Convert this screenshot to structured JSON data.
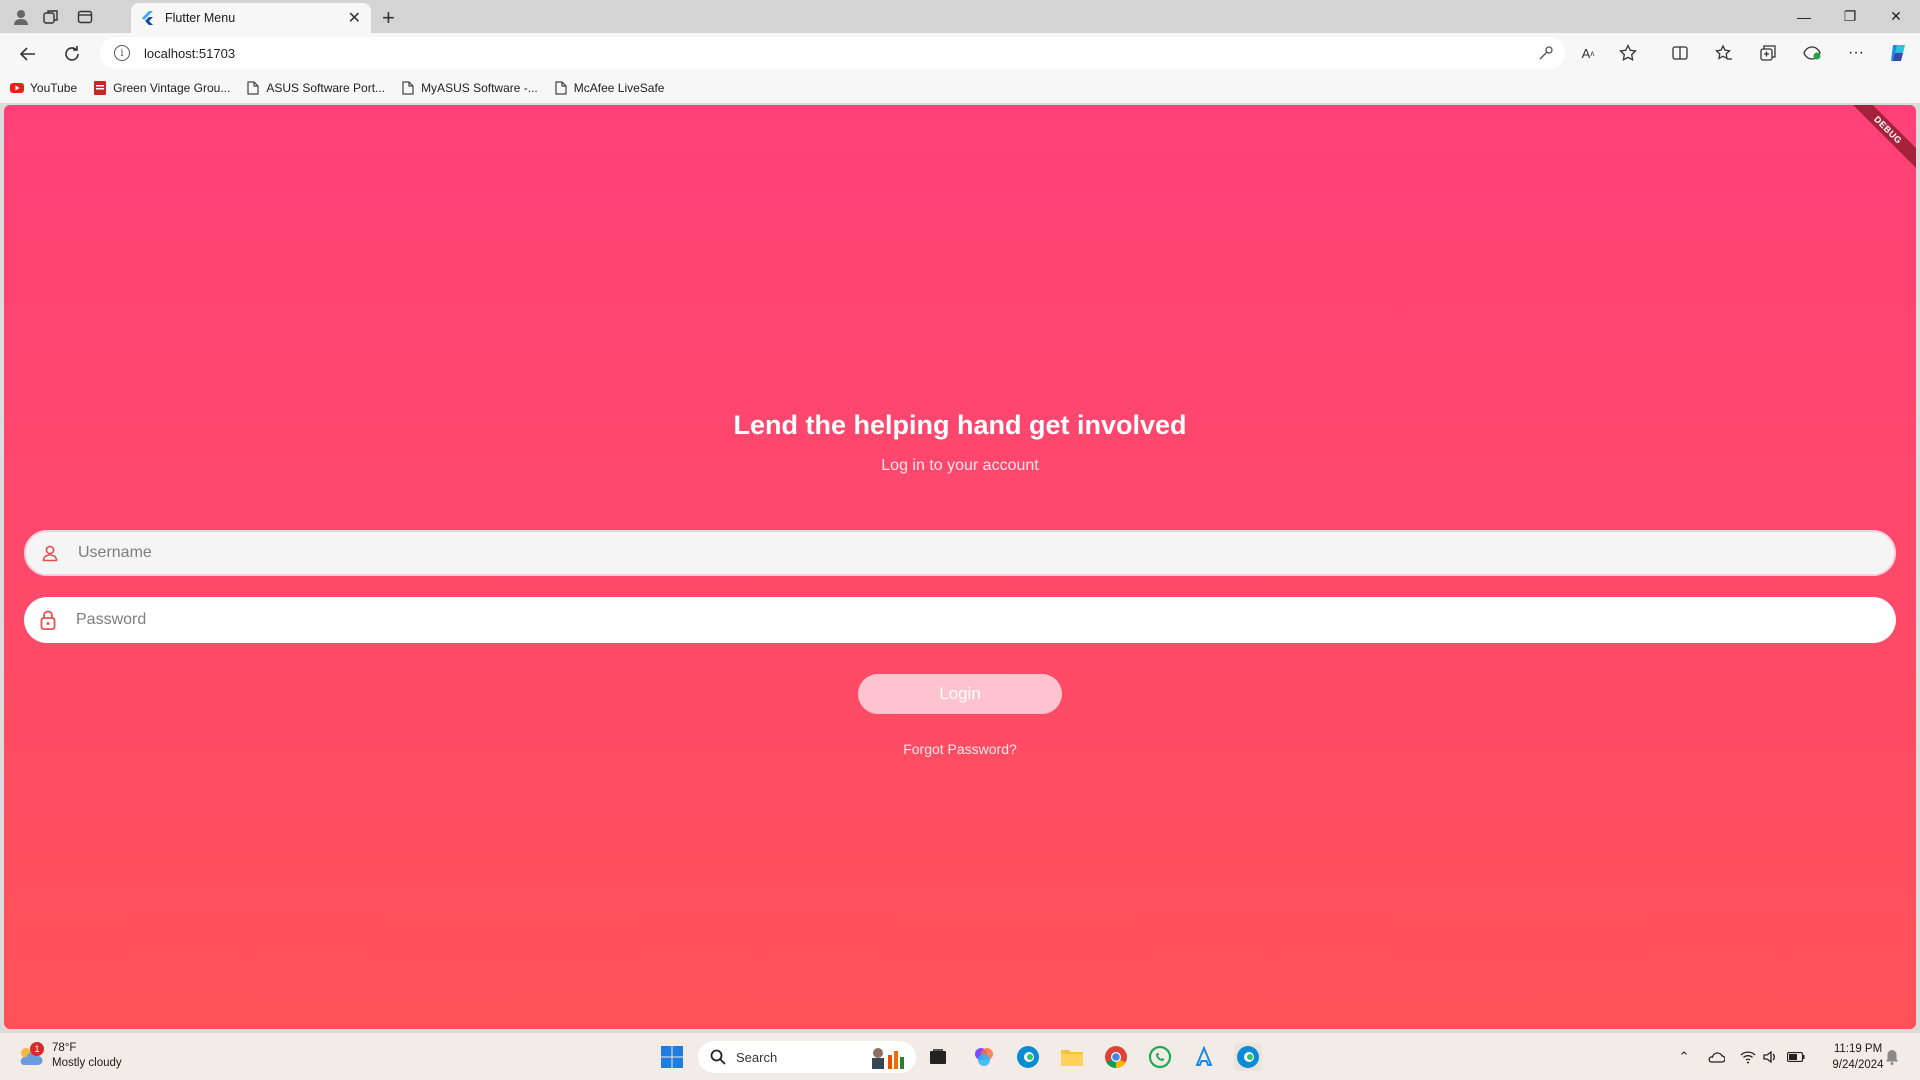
{
  "browser": {
    "tab_title": "Flutter Menu",
    "url": "localhost:51703",
    "bookmarks": [
      {
        "label": "YouTube",
        "icon": "youtube-icon"
      },
      {
        "label": "Green Vintage Grou...",
        "icon": "pdf-icon"
      },
      {
        "label": "ASUS Software Port...",
        "icon": "page-icon"
      },
      {
        "label": "MyASUS Software -...",
        "icon": "page-icon"
      },
      {
        "label": "McAfee LiveSafe",
        "icon": "page-icon"
      }
    ]
  },
  "app": {
    "debug_banner": "DEBUG",
    "headline": "Lend the helping hand get involved",
    "subtitle": "Log in to your account",
    "username_placeholder": "Username",
    "password_placeholder": "Password",
    "login_label": "Login",
    "forgot_label": "Forgot Password?",
    "colors": {
      "gradient_top": "#ff4178",
      "gradient_bottom": "#ff5258",
      "button": "#ffc3cf"
    }
  },
  "taskbar": {
    "weather_temp": "78°F",
    "weather_desc": "Mostly cloudy",
    "weather_badge": "1",
    "search_label": "Search",
    "time": "11:19 PM",
    "date": "9/24/2024"
  }
}
